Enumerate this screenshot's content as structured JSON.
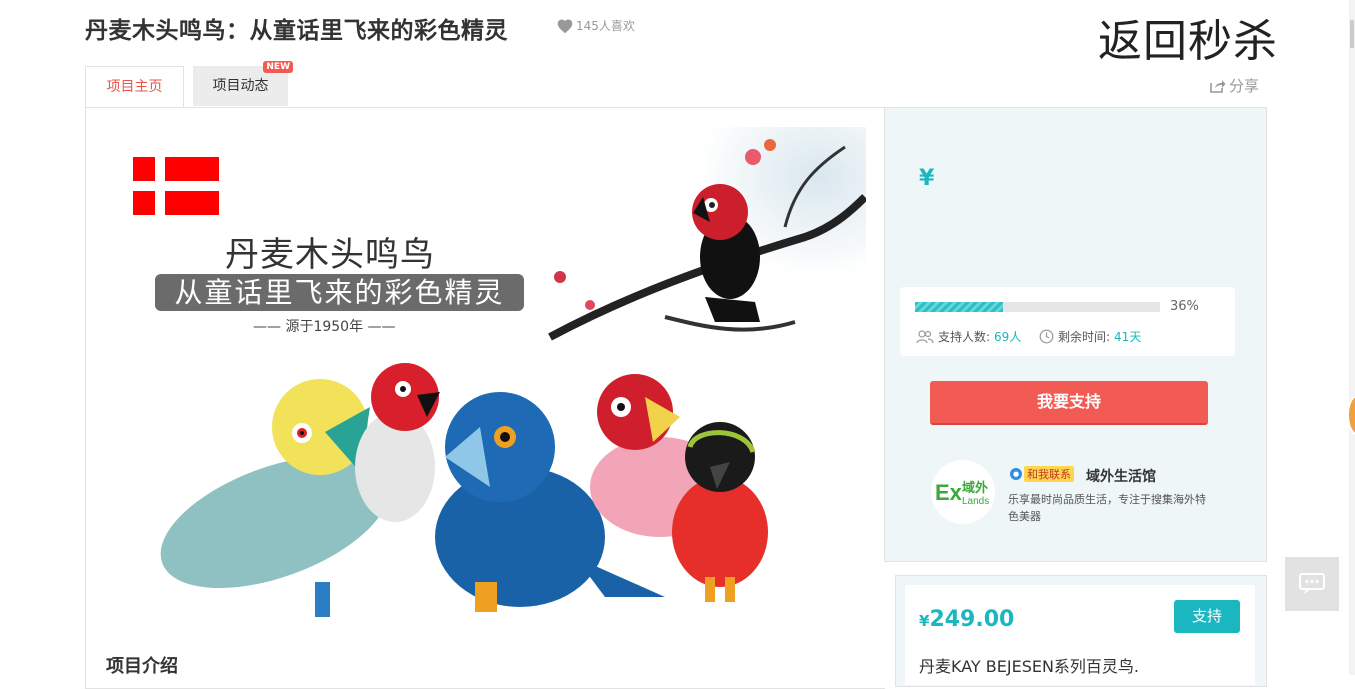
{
  "header": {
    "title": "丹麦木头鸣鸟：从童话里飞来的彩色精灵",
    "likes": "145人喜欢",
    "flash_back": "返回秒杀"
  },
  "tabs": [
    {
      "label": "项目主页",
      "active": true
    },
    {
      "label": "项目动态",
      "badge": "NEW"
    }
  ],
  "share_label": "分享",
  "hero": {
    "heading": "丹麦木头鸣鸟",
    "subheading": "从童话里飞来的彩色精灵",
    "since": "—— 源于1950年 ——"
  },
  "section_intro": "项目介绍",
  "funding": {
    "currency": "¥",
    "progress_percent": 36,
    "progress_label": "36%",
    "supporters_label": "支持人数:",
    "supporters_value": "69人",
    "time_left_label": "剩余时间:",
    "time_left_value": "41天",
    "support_button": "我要支持"
  },
  "store": {
    "contact_label": "和我联系",
    "name": "域外生活馆",
    "description": "乐享最时尚品质生活，专注于搜集海外特色美器",
    "logo_text": "Ex域外Lands"
  },
  "reward": {
    "currency": "¥",
    "amount": "249.00",
    "button": "支持",
    "description": "丹麦KAY BEJESEN系列百灵鸟."
  },
  "colors": {
    "accent": "#1ab7c0",
    "danger": "#f25b53",
    "tab_active": "#e8564a"
  },
  "icons": [
    "heart-icon",
    "share-icon",
    "supporters-icon",
    "clock-icon",
    "chat-icon"
  ]
}
